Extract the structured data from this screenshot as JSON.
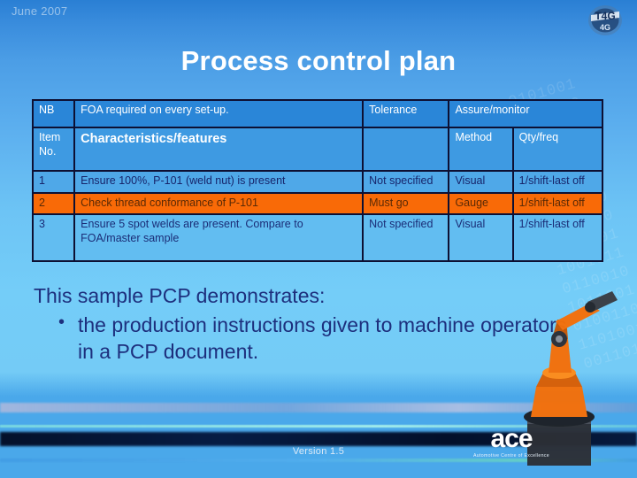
{
  "slide": {
    "date_label": "June 2007",
    "title": "Process control plan",
    "version": "Version 1.5"
  },
  "logos": {
    "corner_logo_text": "T4G",
    "ace_word": "ace",
    "ace_subtitle": "Automotive Centre of Excellence"
  },
  "table": {
    "note_row": {
      "label": "NB",
      "note": "FOA required on every set-up.",
      "tolerance_header": "Tolerance",
      "assure_header": "Assure/monitor"
    },
    "header_row": {
      "item_no": "Item No.",
      "characteristics": "Characteristics/features",
      "tolerance": "",
      "method": "Method",
      "qty_freq": "Qty/freq"
    },
    "rows": [
      {
        "item": "1",
        "characteristic": "Ensure 100%, P-101 (weld nut) is present",
        "tolerance": "Not specified",
        "method": "Visual",
        "qty_freq": "1/shift-last off",
        "highlight": "none"
      },
      {
        "item": "2",
        "characteristic": "Check thread conformance of P-101",
        "tolerance": "Must go",
        "method": "Gauge",
        "qty_freq": "1/shift-last off",
        "highlight": "orange"
      },
      {
        "item": "3",
        "characteristic": "Ensure 5 spot welds are present. Compare to FOA/master sample",
        "tolerance": "Not specified",
        "method": "Visual",
        "qty_freq": "1/shift-last off",
        "highlight": "light"
      }
    ]
  },
  "body": {
    "lead": "This sample PCP demonstrates:",
    "bullets": [
      "the production instructions given to machine operators in a PCP document."
    ]
  },
  "colors": {
    "accent_orange": "#f96a07",
    "table_border": "#0d1033",
    "text_navy": "#1d2f7d",
    "header_blue": "#2a86d8"
  },
  "watermark_text": "0101001\n1001010\n0110100\n1010011\n0101101\n1100101\n0011010\n1010110\n0101001\n1001011\n0110010\n1011001\n0100110\n1101001\n0011011"
}
